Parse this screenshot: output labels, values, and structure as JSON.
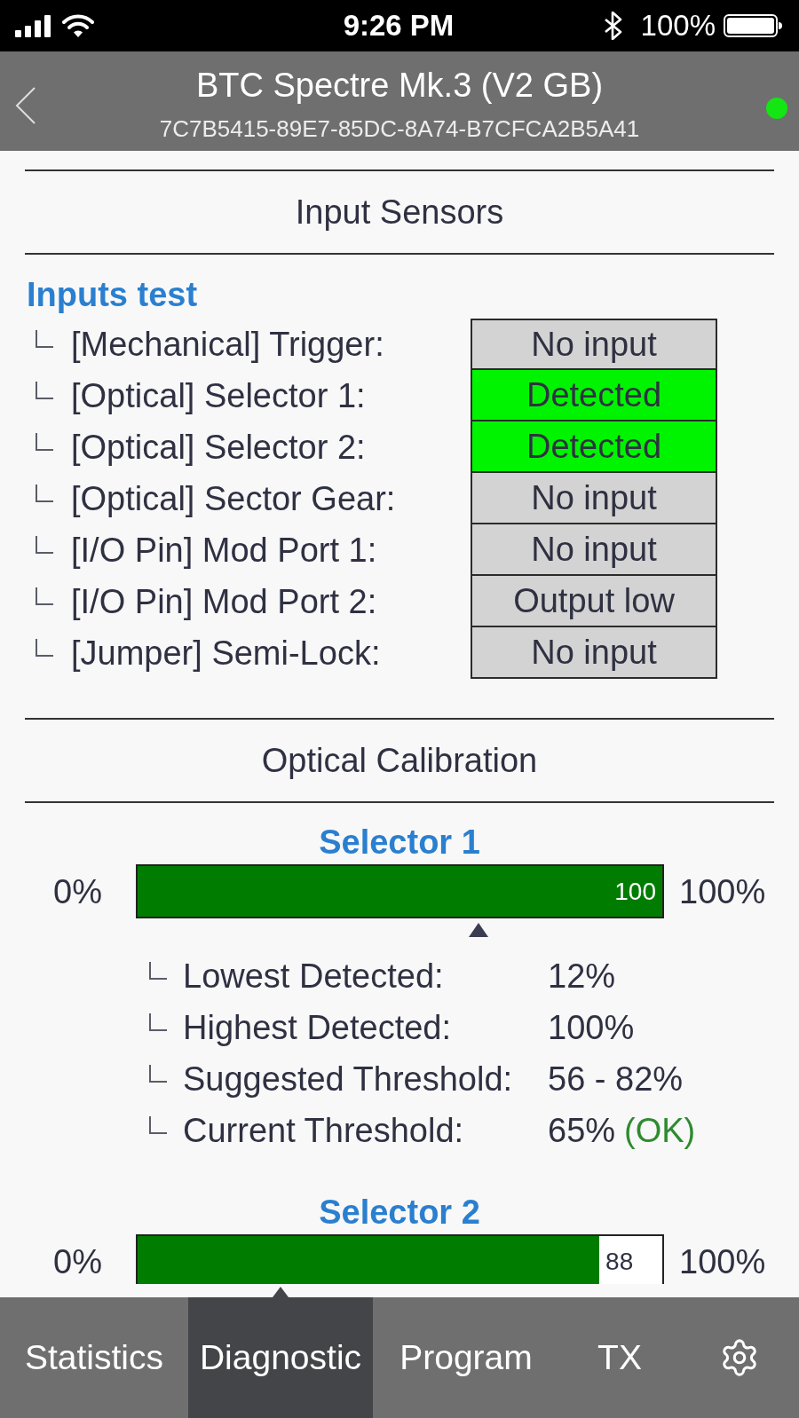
{
  "status_bar": {
    "time": "9:26 PM",
    "battery": "100%"
  },
  "header": {
    "title": "BTC Spectre Mk.3 (V2 GB)",
    "subtitle": "7C7B5415-89E7-85DC-8A74-B7CFCA2B5A41",
    "connected": true
  },
  "input_sensors": {
    "title": "Input Sensors",
    "group": "Inputs test",
    "rows": [
      {
        "label": "[Mechanical] Trigger:",
        "status": "No input",
        "detected": false
      },
      {
        "label": "[Optical] Selector 1:",
        "status": "Detected",
        "detected": true
      },
      {
        "label": "[Optical] Selector 2:",
        "status": "Detected",
        "detected": true
      },
      {
        "label": "[Optical] Sector Gear:",
        "status": "No input",
        "detected": false
      },
      {
        "label": "[I/O Pin] Mod Port 1:",
        "status": "No input",
        "detected": false
      },
      {
        "label": "[I/O Pin] Mod Port 2:",
        "status": "Output low",
        "detected": false
      },
      {
        "label": "[Jumper] Semi-Lock:",
        "status": "No input",
        "detected": false
      }
    ]
  },
  "optical_calibration": {
    "title": "Optical Calibration",
    "selectors": [
      {
        "title": "Selector 1",
        "min_label": "0%",
        "max_label": "100%",
        "level": 1,
        "value": "100",
        "threshold": {
          "level": 0.65
        },
        "stats": [
          {
            "label": "Lowest Detected:",
            "value": "12%"
          },
          {
            "label": "Highest Detected:",
            "value": "100%"
          },
          {
            "label": "Suggested Threshold:",
            "value": "56 - 82%"
          },
          {
            "label": "Current Threshold:",
            "value": "65%",
            "note": "(OK)"
          }
        ]
      },
      {
        "title": "Selector 2",
        "min_label": "0%",
        "max_label": "100%",
        "level": 0.88,
        "value": "88"
      }
    ]
  },
  "tabs": [
    {
      "kind": "text",
      "label": "Statistics",
      "selected": false
    },
    {
      "kind": "text",
      "label": "Diagnostic",
      "selected": true
    },
    {
      "kind": "text",
      "label": "Program",
      "selected": false
    },
    {
      "kind": "text",
      "label": "TX",
      "selected": false
    },
    {
      "kind": "settings",
      "selected": false
    }
  ]
}
